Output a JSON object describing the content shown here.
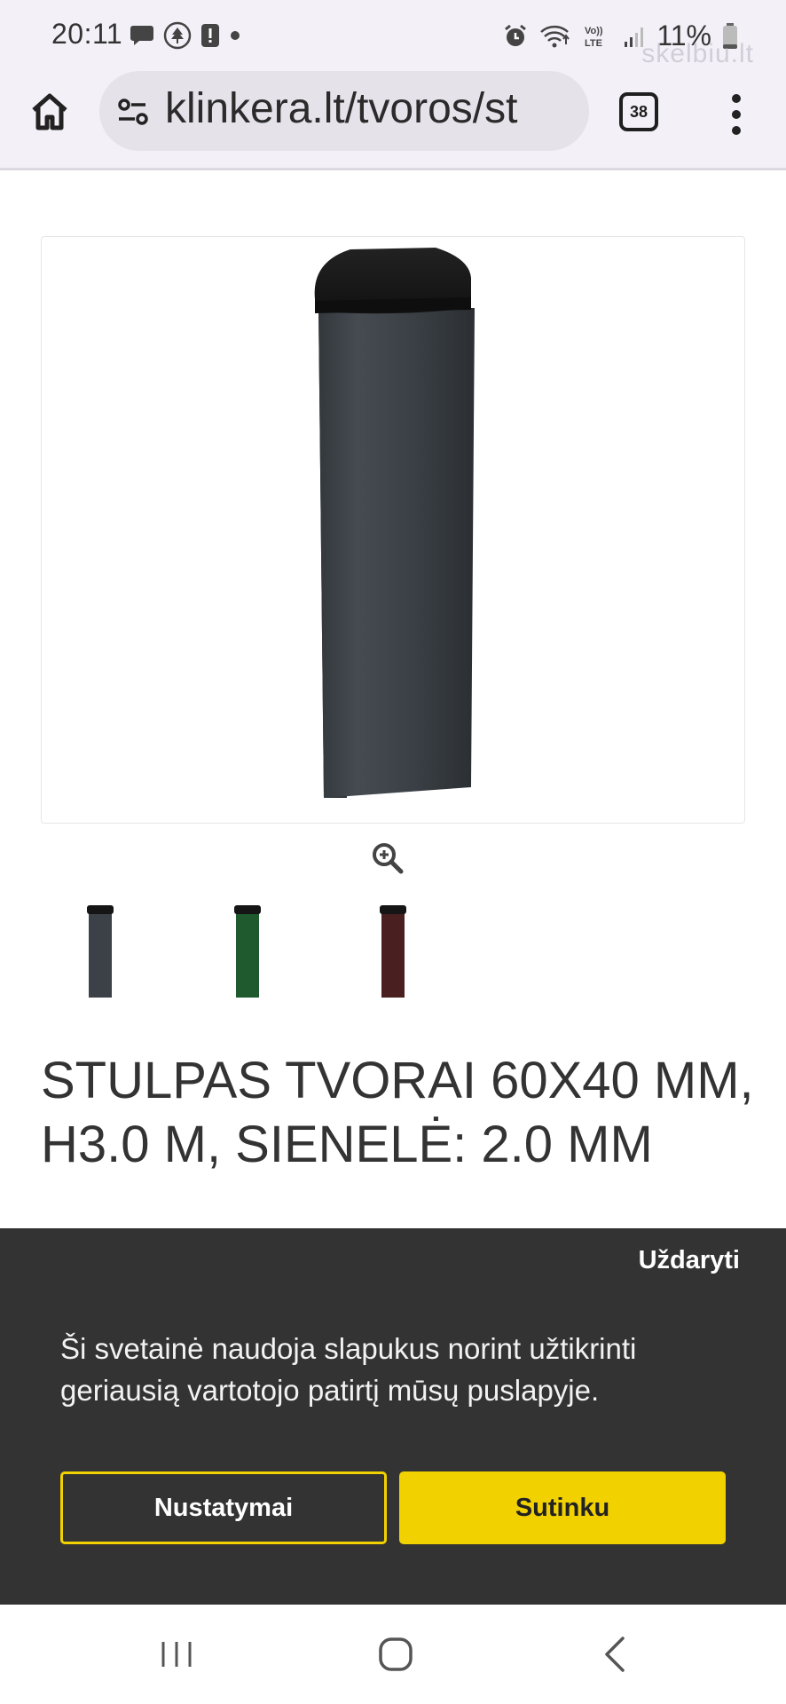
{
  "status_bar": {
    "time": "20:11",
    "battery": "11%",
    "watermark": "skelbiu.lt",
    "icons_left": [
      "chat-icon",
      "tree-logo-icon",
      "alert-icon",
      "dot-icon"
    ],
    "icons_right": [
      "alarm-icon",
      "wifi-icon",
      "volte-icon",
      "signal-icon",
      "battery-icon"
    ]
  },
  "browser": {
    "url": "klinkera.lt/tvoros/st",
    "tab_count": "38"
  },
  "product": {
    "title": "STULPAS TVORAI 60X40 MM, H3.0 M, SIENELĖ: 2.0 MM",
    "thumbnails": [
      {
        "color_name": "anthracite",
        "color": "#3b4147"
      },
      {
        "color_name": "green",
        "color": "#1e5a2e"
      },
      {
        "color_name": "brown",
        "color": "#4a1f1f"
      }
    ]
  },
  "cookie_banner": {
    "close_label": "Uždaryti",
    "message": "Ši svetainė naudoja slapukus norint užtikrinti geriausią vartotojo patirtį mūsų puslapyje.",
    "settings_label": "Nustatymai",
    "accept_label": "Sutinku",
    "accent_color": "#f2d100"
  },
  "nav_bar": {
    "buttons": [
      "recent-apps",
      "home",
      "back"
    ]
  }
}
